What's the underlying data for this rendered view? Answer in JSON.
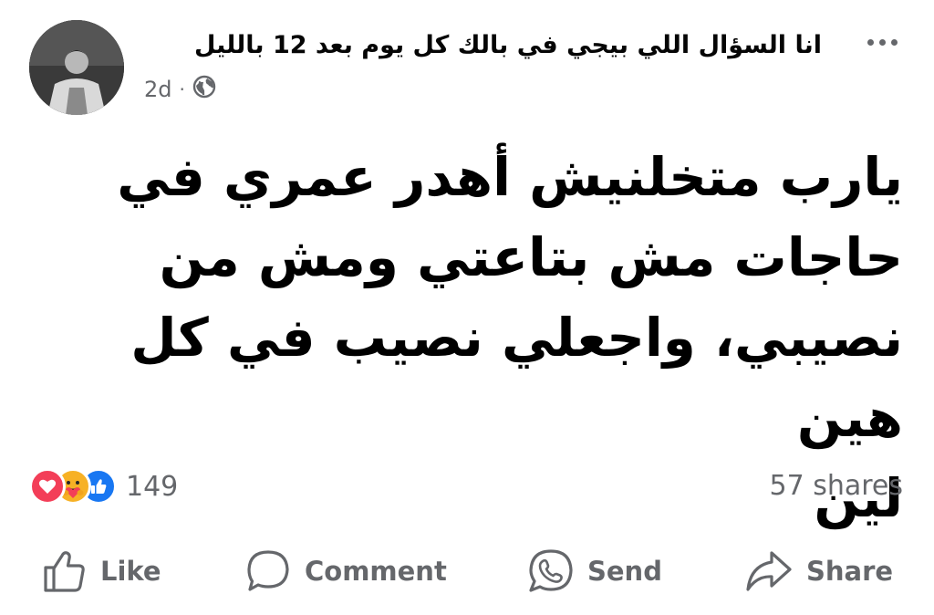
{
  "post": {
    "page_name": "انا السؤال اللي بيجي في بالك كل يوم بعد 12 بالليل",
    "time": "2d",
    "separator": "·",
    "audience_icon": "globe-icon",
    "more_icon": "more-options-icon",
    "text_lines": [
      "يارب متخلنيش أهدر عمري في",
      "حاجات مش بتاعتي ومش من",
      "نصيبي، واجعلي نصيب في كل هين",
      "لين"
    ]
  },
  "stats": {
    "reactions": [
      "love-reaction-icon",
      "care-reaction-icon",
      "like-reaction-icon"
    ],
    "reaction_count": "149",
    "shares": "57 shares"
  },
  "actions": {
    "like": "Like",
    "comment": "Comment",
    "send": "Send",
    "share": "Share"
  },
  "colors": {
    "secondary_text": "#65676b",
    "like_blue": "#1877f2",
    "love_red": "#f33e58",
    "care_yellow": "#f7b125"
  }
}
